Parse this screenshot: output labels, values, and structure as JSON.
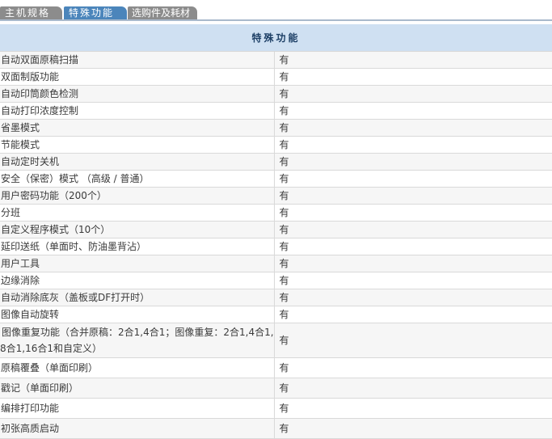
{
  "tabs": [
    {
      "label": "主机规格"
    },
    {
      "label": "特殊功能"
    },
    {
      "label": "选购件及耗材"
    }
  ],
  "table": {
    "header": "特殊功能",
    "rows": [
      {
        "feature": "自动双面原稿扫描",
        "value": "有"
      },
      {
        "feature": "双面制版功能",
        "value": "有"
      },
      {
        "feature": "自动印筒颜色检测",
        "value": "有"
      },
      {
        "feature": "自动打印浓度控制",
        "value": "有"
      },
      {
        "feature": "省墨模式",
        "value": "有"
      },
      {
        "feature": "节能模式",
        "value": "有"
      },
      {
        "feature": "自动定时关机",
        "value": "有"
      },
      {
        "feature": "安全（保密）模式 （高级 / 普通）",
        "value": "有"
      },
      {
        "feature": "用户密码功能（200个）",
        "value": "有"
      },
      {
        "feature": "分班",
        "value": "有"
      },
      {
        "feature": "自定义程序模式（10个）",
        "value": "有"
      },
      {
        "feature": "延印送纸（单面时、防油墨背沾）",
        "value": "有"
      },
      {
        "feature": "用户工具",
        "value": "有"
      },
      {
        "feature": "边缘消除",
        "value": "有"
      },
      {
        "feature": "自动消除底灰（盖板或DF打开时）",
        "value": "有"
      },
      {
        "feature": "图像自动旋转",
        "value": "有"
      },
      {
        "feature_line1": "图像重复功能（合并原稿：2合1,4合1；图像重复：2合1,4合1,",
        "feature_line2": "8合1,16合1和自定义）",
        "value": "有"
      },
      {
        "feature": "原稿覆叠（单面印刷）",
        "value": "有"
      },
      {
        "feature": "戳记（单面印刷）",
        "value": "有"
      },
      {
        "feature": "编排打印功能",
        "value": "有"
      },
      {
        "feature": "初张高质启动",
        "value": "有"
      }
    ]
  }
}
